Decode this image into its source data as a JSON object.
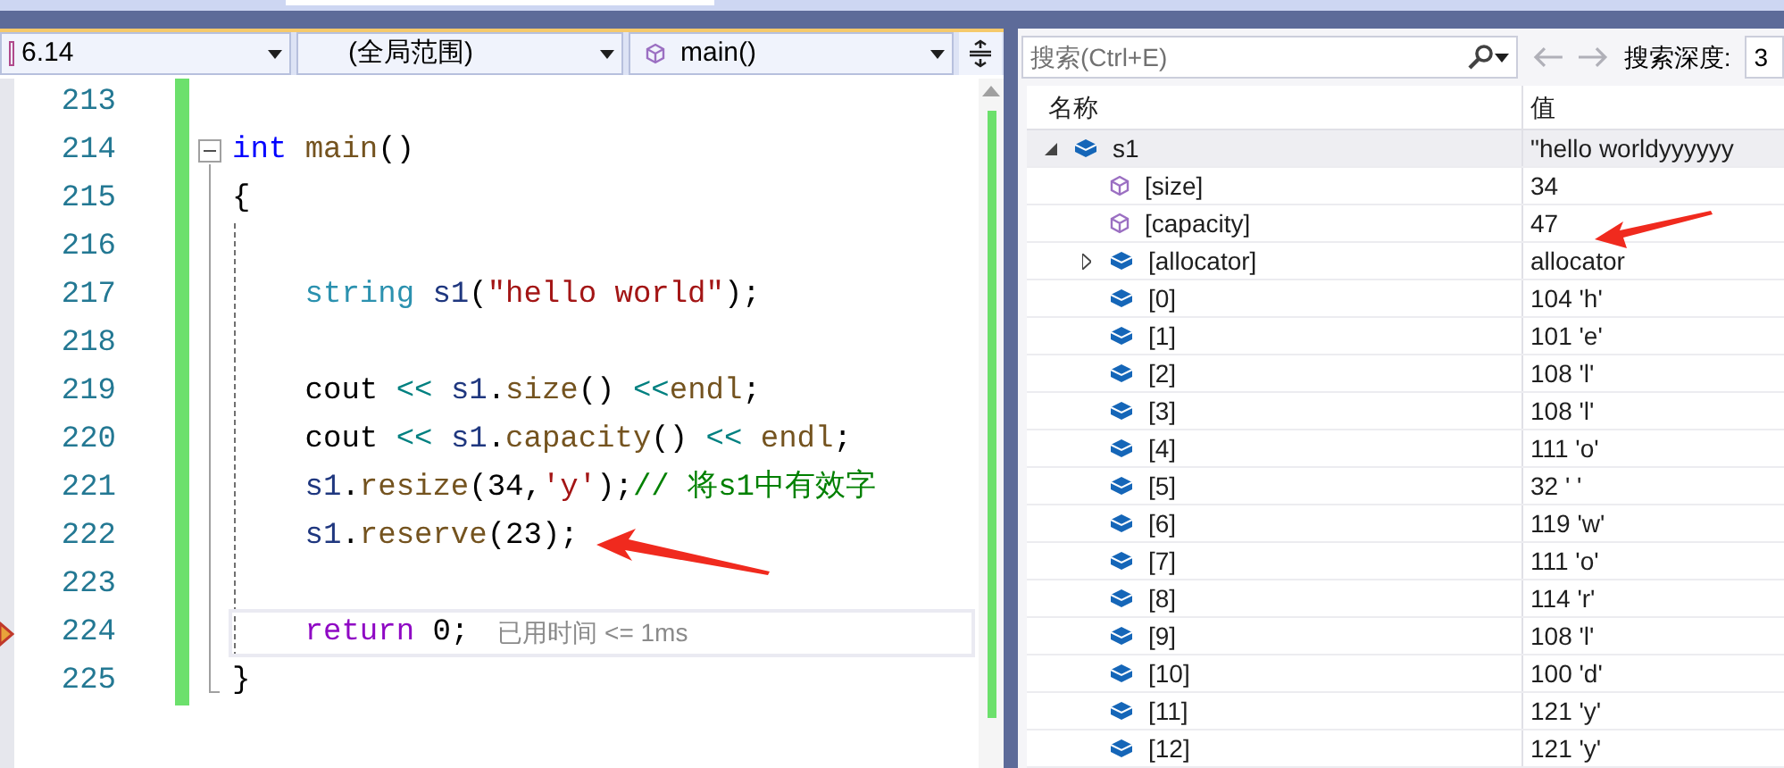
{
  "editor": {
    "file_dropdown": "6.14",
    "scope_dropdown": "(全局范围)",
    "function_dropdown": "main()",
    "lines": [
      {
        "number": "213",
        "current": false
      },
      {
        "number": "214",
        "current": false,
        "fold": {
          "expanded": true
        },
        "tokens": [
          {
            "kind": "keyword",
            "t": "int "
          },
          {
            "kind": "func",
            "t": "main"
          },
          {
            "kind": "plain",
            "t": "()"
          }
        ]
      },
      {
        "number": "215",
        "current": false,
        "tokens": [
          {
            "kind": "plain",
            "t": "{"
          }
        ]
      },
      {
        "number": "216",
        "current": false
      },
      {
        "number": "217",
        "current": false,
        "tokens": [
          {
            "kind": "type",
            "t": "    string "
          },
          {
            "kind": "var",
            "t": "s1"
          },
          {
            "kind": "plain",
            "t": "("
          },
          {
            "kind": "string",
            "t": "\"hello world\""
          },
          {
            "kind": "plain",
            "t": ");"
          }
        ]
      },
      {
        "number": "218",
        "current": false
      },
      {
        "number": "219",
        "current": false,
        "tokens": [
          {
            "kind": "plain",
            "t": "    cout "
          },
          {
            "kind": "op",
            "t": "<< "
          },
          {
            "kind": "var",
            "t": "s1"
          },
          {
            "kind": "plain",
            "t": "."
          },
          {
            "kind": "func",
            "t": "size"
          },
          {
            "kind": "plain",
            "t": "() "
          },
          {
            "kind": "op",
            "t": "<<"
          },
          {
            "kind": "func",
            "t": "endl"
          },
          {
            "kind": "plain",
            "t": ";"
          }
        ]
      },
      {
        "number": "220",
        "current": false,
        "tokens": [
          {
            "kind": "plain",
            "t": "    cout "
          },
          {
            "kind": "op",
            "t": "<< "
          },
          {
            "kind": "var",
            "t": "s1"
          },
          {
            "kind": "plain",
            "t": "."
          },
          {
            "kind": "func",
            "t": "capacity"
          },
          {
            "kind": "plain",
            "t": "() "
          },
          {
            "kind": "op",
            "t": "<< "
          },
          {
            "kind": "func",
            "t": "endl"
          },
          {
            "kind": "plain",
            "t": ";"
          }
        ]
      },
      {
        "number": "221",
        "current": false,
        "tokens": [
          {
            "kind": "var",
            "t": "    s1"
          },
          {
            "kind": "plain",
            "t": "."
          },
          {
            "kind": "func",
            "t": "resize"
          },
          {
            "kind": "plain",
            "t": "(34,"
          },
          {
            "kind": "string",
            "t": "'y'"
          },
          {
            "kind": "plain",
            "t": ");"
          },
          {
            "kind": "comment",
            "t": "// 将s1中有效字"
          }
        ]
      },
      {
        "number": "222",
        "current": false,
        "tokens": [
          {
            "kind": "var",
            "t": "    s1"
          },
          {
            "kind": "plain",
            "t": "."
          },
          {
            "kind": "func",
            "t": "reserve"
          },
          {
            "kind": "plain",
            "t": "(23);"
          }
        ]
      },
      {
        "number": "223",
        "current": false
      },
      {
        "number": "224",
        "current": true,
        "hint": "已用时间 <= 1ms",
        "tokens": [
          {
            "kind": "control",
            "t": "    return "
          },
          {
            "kind": "plain",
            "t": "0;"
          }
        ]
      },
      {
        "number": "225",
        "current": false,
        "tokens": [
          {
            "kind": "plain",
            "t": "}"
          }
        ]
      }
    ]
  },
  "watch": {
    "search": {
      "placeholder": "搜索(Ctrl+E)"
    },
    "depth_label": "搜索深度:",
    "depth_value": "3",
    "columns": [
      "名称",
      "值"
    ],
    "rows": [
      {
        "name": "s1",
        "value": "\"hello worldyyyyyy",
        "kind": "object",
        "selected": true,
        "expanded": true,
        "children": [
          {
            "name": "[size]",
            "value": "34",
            "kind": "property",
            "selected": false
          },
          {
            "name": "[capacity]",
            "value": "47",
            "kind": "property",
            "selected": false
          },
          {
            "name": "[allocator]",
            "value": "allocator",
            "kind": "object",
            "selected": false,
            "expanded": false
          },
          {
            "name": "[0]",
            "value": "104 'h'",
            "kind": "object",
            "selected": false
          },
          {
            "name": "[1]",
            "value": "101 'e'",
            "kind": "object",
            "selected": false
          },
          {
            "name": "[2]",
            "value": "108 'l'",
            "kind": "object",
            "selected": false
          },
          {
            "name": "[3]",
            "value": "108 'l'",
            "kind": "object",
            "selected": false
          },
          {
            "name": "[4]",
            "value": "111 'o'",
            "kind": "object",
            "selected": false
          },
          {
            "name": "[5]",
            "value": "32 ' '",
            "kind": "object",
            "selected": false
          },
          {
            "name": "[6]",
            "value": "119 'w'",
            "kind": "object",
            "selected": false
          },
          {
            "name": "[7]",
            "value": "111 'o'",
            "kind": "object",
            "selected": false
          },
          {
            "name": "[8]",
            "value": "114 'r'",
            "kind": "object",
            "selected": false
          },
          {
            "name": "[9]",
            "value": "108 'l'",
            "kind": "object",
            "selected": false
          },
          {
            "name": "[10]",
            "value": "100 'd'",
            "kind": "object",
            "selected": false
          },
          {
            "name": "[11]",
            "value": "121 'y'",
            "kind": "object",
            "selected": false
          },
          {
            "name": "[12]",
            "value": "121 'y'",
            "kind": "object",
            "selected": false
          }
        ]
      }
    ]
  }
}
